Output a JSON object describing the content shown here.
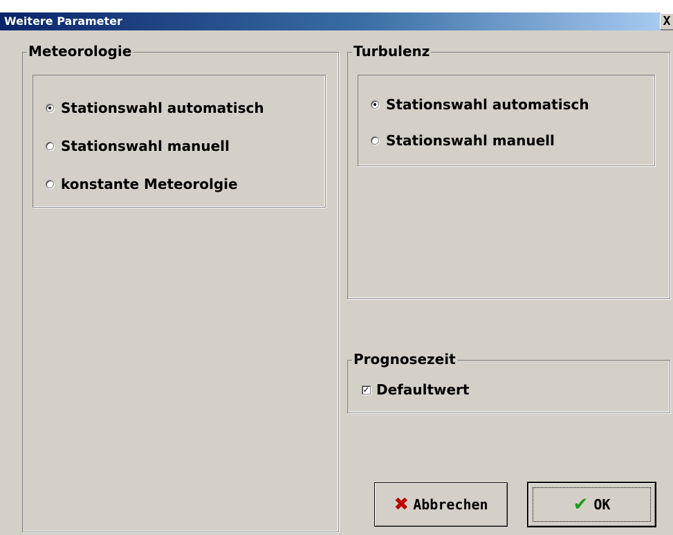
{
  "window": {
    "title": "Weitere Parameter",
    "close_symbol": "X"
  },
  "meteorologie": {
    "title": "Meteorologie",
    "options": [
      {
        "label": "Stationswahl automatisch",
        "checked": true
      },
      {
        "label": "Stationswahl manuell",
        "checked": false
      },
      {
        "label": "konstante Meteorolgie",
        "checked": false
      }
    ]
  },
  "turbulenz": {
    "title": "Turbulenz",
    "options": [
      {
        "label": "Stationswahl automatisch",
        "checked": true
      },
      {
        "label": "Stationswahl manuell",
        "checked": false
      }
    ]
  },
  "prognosezeit": {
    "title": "Prognosezeit",
    "checkbox_label": "Defaultwert",
    "checked": true
  },
  "buttons": {
    "cancel_label": "Abbrechen",
    "cancel_icon": "red-x-icon",
    "ok_label": "OK",
    "ok_icon": "green-check-icon"
  }
}
